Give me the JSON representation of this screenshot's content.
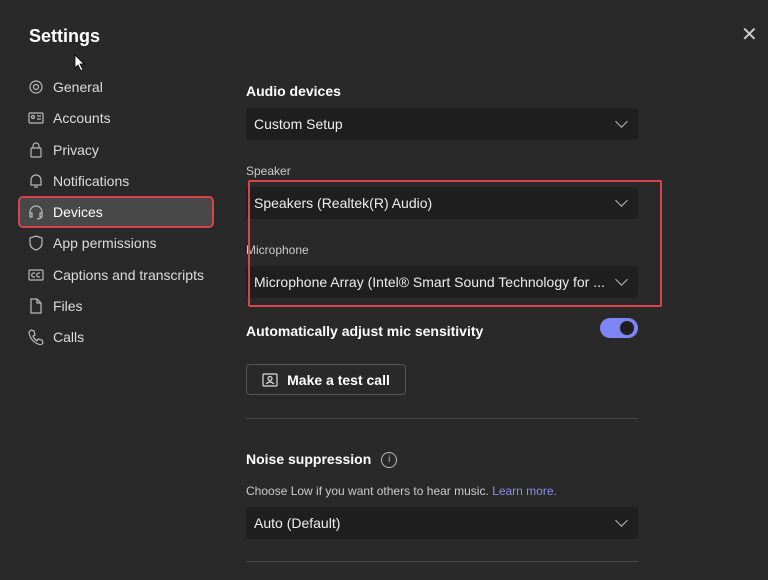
{
  "title": "Settings",
  "nav": [
    {
      "label": "General",
      "icon": "gear-icon"
    },
    {
      "label": "Accounts",
      "icon": "id-card-icon"
    },
    {
      "label": "Privacy",
      "icon": "lock-icon"
    },
    {
      "label": "Notifications",
      "icon": "bell-icon"
    },
    {
      "label": "Devices",
      "icon": "headset-icon",
      "active": true
    },
    {
      "label": "App permissions",
      "icon": "shield-icon"
    },
    {
      "label": "Captions and transcripts",
      "icon": "cc-icon"
    },
    {
      "label": "Files",
      "icon": "file-icon"
    },
    {
      "label": "Calls",
      "icon": "phone-icon"
    }
  ],
  "audio": {
    "heading": "Audio devices",
    "value": "Custom Setup"
  },
  "speaker": {
    "label": "Speaker",
    "value": "Speakers (Realtek(R) Audio)"
  },
  "microphone": {
    "label": "Microphone",
    "value": "Microphone Array (Intel® Smart Sound Technology for ..."
  },
  "auto_adjust": {
    "label": "Automatically adjust mic sensitivity",
    "on": true
  },
  "test_call": "Make a test call",
  "noise": {
    "heading": "Noise suppression",
    "info": "i",
    "desc": "Choose Low if you want others to hear music.",
    "link": "Learn more.",
    "value": "Auto (Default)"
  },
  "colors": {
    "accent": "#7f85f5",
    "highlight": "#d9434a",
    "bg": "#292929"
  }
}
